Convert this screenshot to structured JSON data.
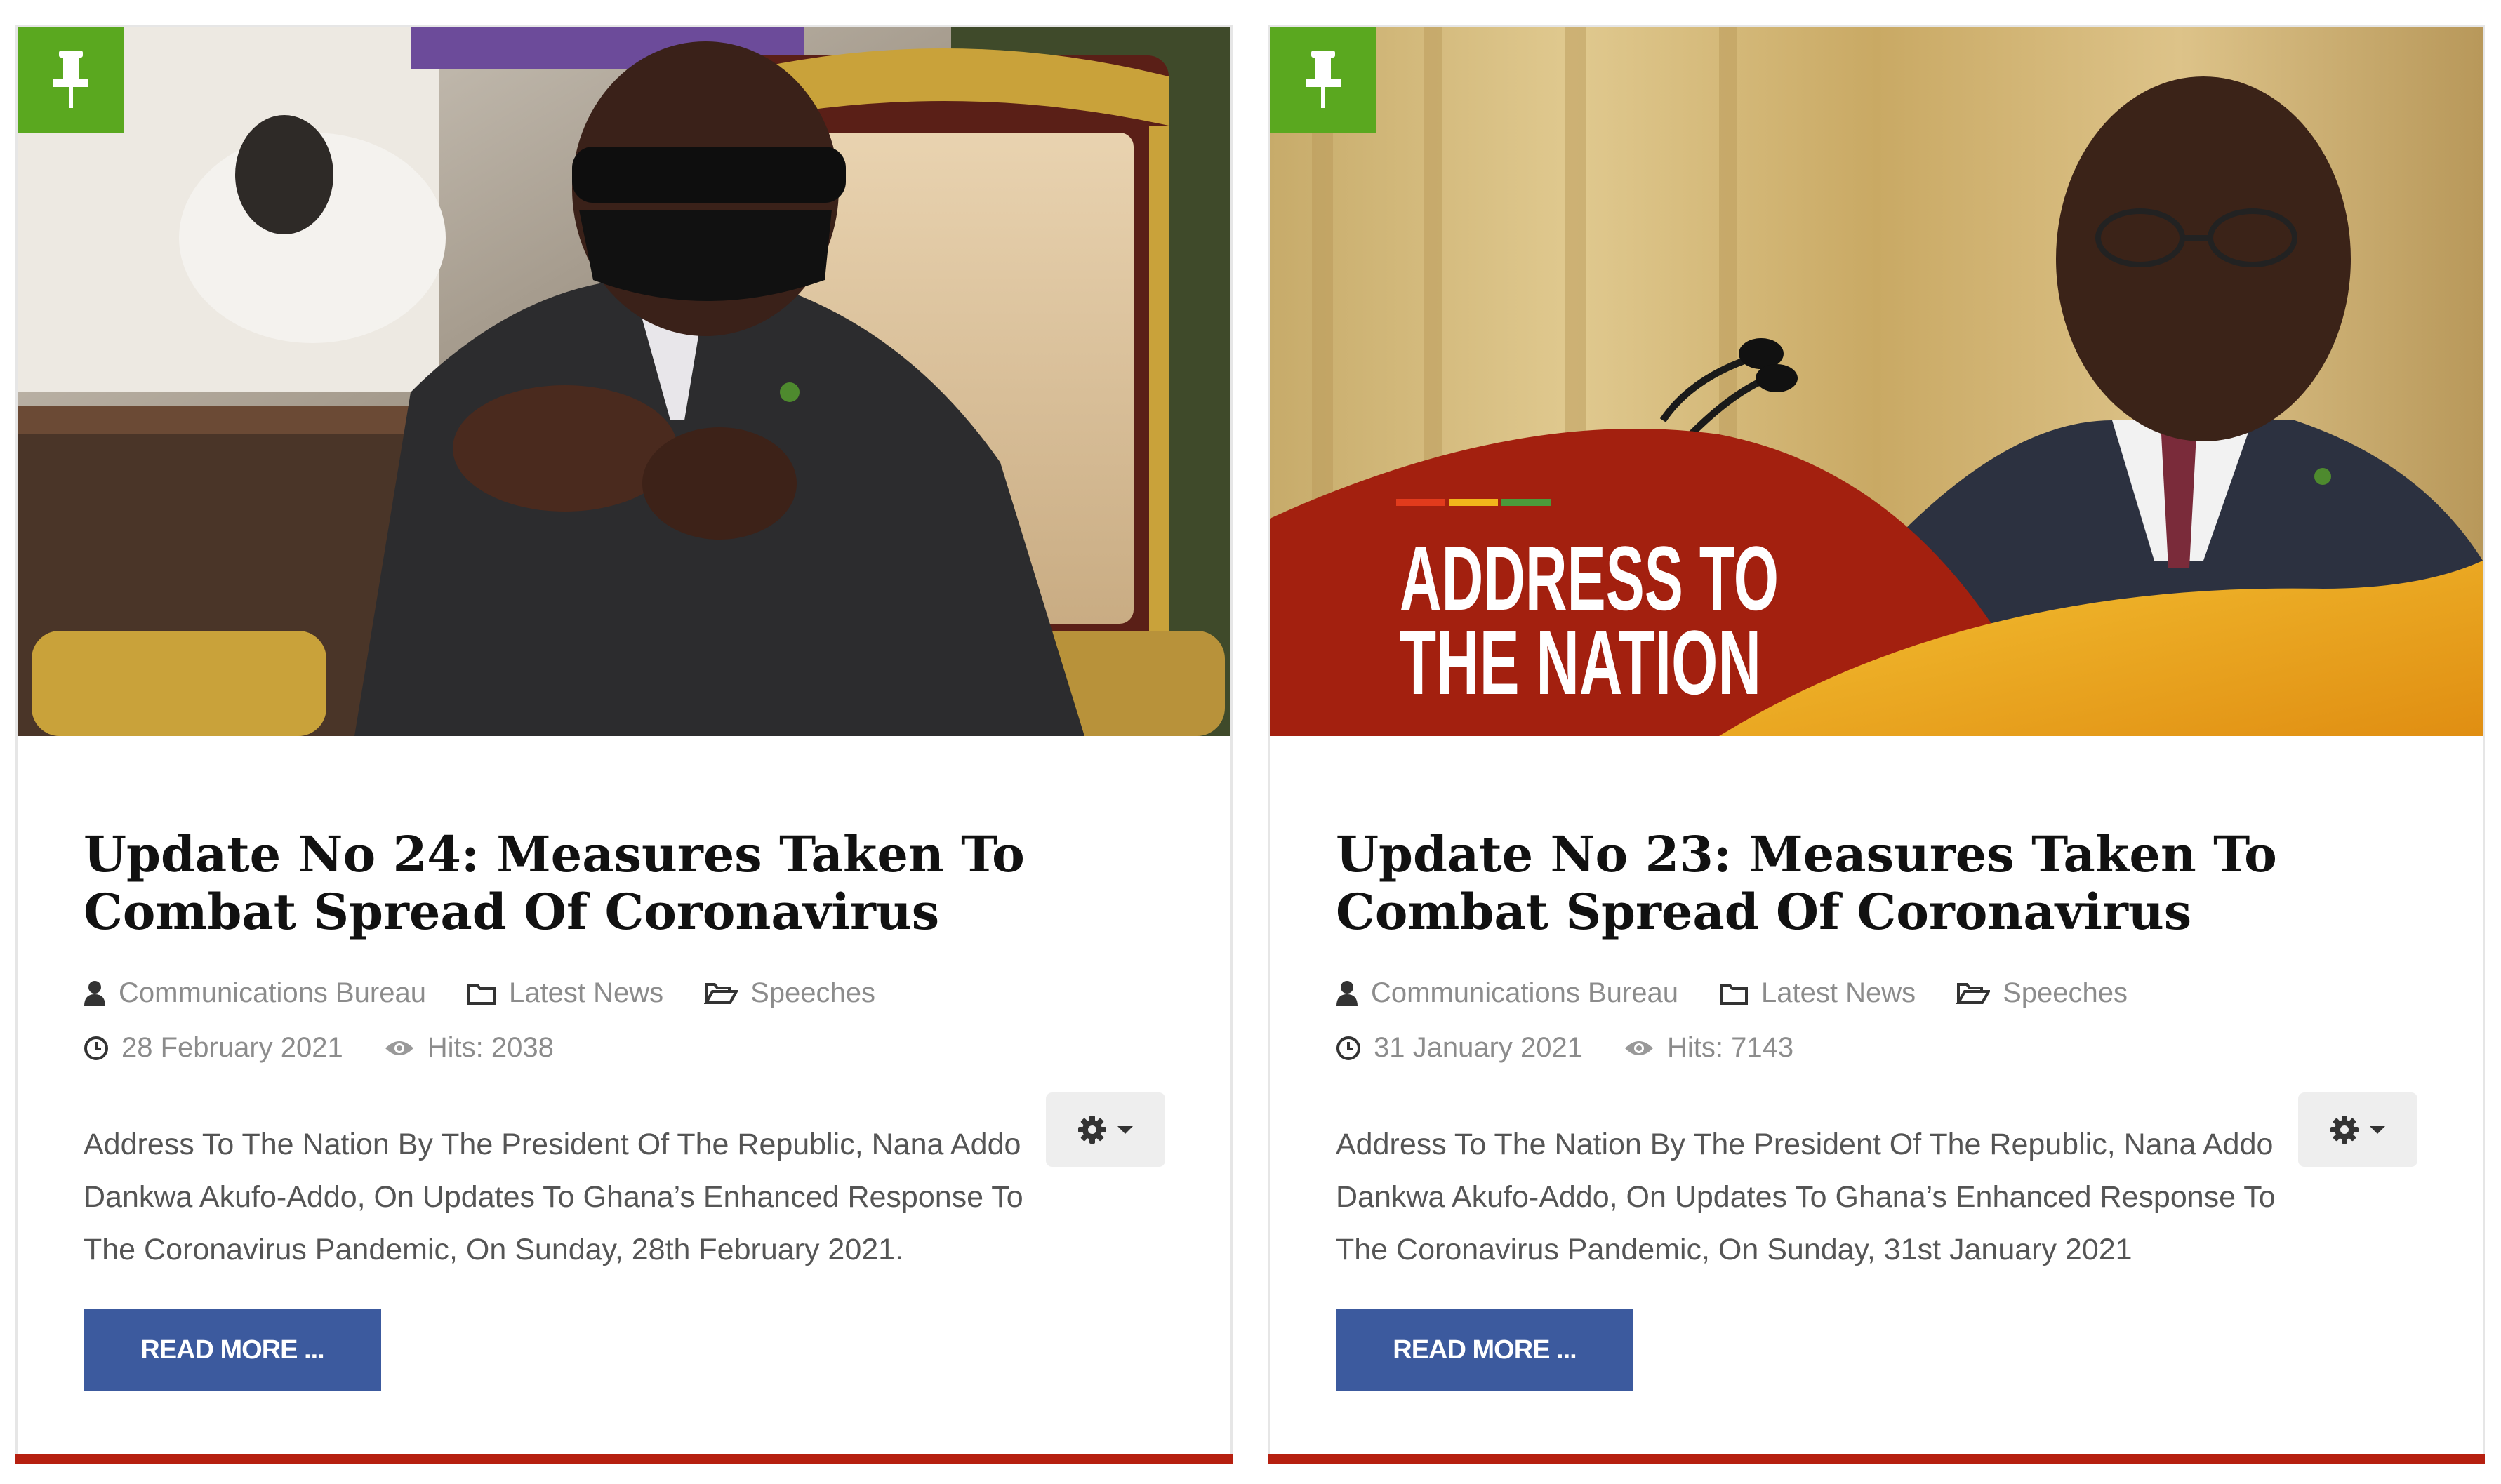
{
  "colors": {
    "pin_badge": "#5aa81f",
    "read_more_button": "#3c5a9e",
    "card_bottom_bar": "#b62010",
    "meta_text": "#8c8c8c"
  },
  "icons": {
    "pin": "thumbtack-icon",
    "author": "user-icon",
    "category": "folder-icon",
    "tag": "folder-open-icon",
    "date": "clock-icon",
    "hits": "eye-icon",
    "tools": "gear-icon"
  },
  "articles": [
    {
      "title": "Update No 24: Measures Taken To Combat Spread Of Coronavirus",
      "author": "Communications Bureau",
      "category": "Latest News",
      "tag": "Speeches",
      "date": "28 February 2021",
      "hits": "Hits: 2038",
      "intro": "Address To The Nation By The President Of The Republic, Nana Addo Dankwa Akufo-Addo, On Updates To Ghana’s Enhanced Response To The Coronavirus Pandemic, On Sunday, 28th February 2021.",
      "read_more": "READ MORE ..."
    },
    {
      "title": "Update No 23: Measures Taken To Combat Spread Of Coronavirus",
      "author": "Communications Bureau",
      "category": "Latest News",
      "tag": "Speeches",
      "date": "31 January 2021",
      "hits": "Hits: 7143",
      "intro": "Address To The Nation By The President Of The Republic, Nana Addo Dankwa Akufo-Addo, On Updates To Ghana’s Enhanced Response To The Coronavirus Pandemic, On Sunday, 31st January 2021",
      "read_more": "READ MORE ...",
      "image_banner_line1": "ADDRESS TO",
      "image_banner_line2": "THE NATION"
    }
  ]
}
